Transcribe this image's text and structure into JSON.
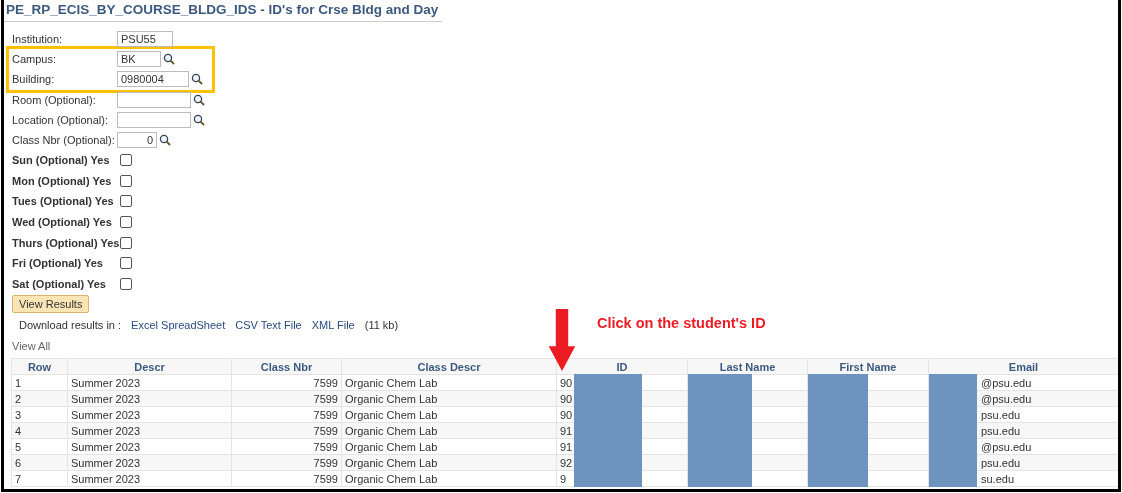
{
  "page_title": "PE_RP_ECIS_BY_COURSE_BLDG_IDS - ID's for Crse Bldg and Day",
  "fields": [
    {
      "label": "Institution:",
      "value": "PSU55",
      "kind": "plain",
      "highlighted": false
    },
    {
      "label": "Campus:",
      "value": "BK",
      "kind": "lookup",
      "highlighted": true
    },
    {
      "label": "Building:",
      "value": "0980004",
      "kind": "lookup",
      "highlighted": true
    },
    {
      "label": "Room (Optional):",
      "kind": "lookup",
      "highlighted": false
    },
    {
      "label": "Location (Optional):",
      "kind": "lookup",
      "highlighted": false
    },
    {
      "label": "Class Nbr (Optional):",
      "value": "0",
      "kind": "number",
      "highlighted": false
    }
  ],
  "day_options": [
    {
      "label": "Sun (Optional) Yes",
      "checked": false
    },
    {
      "label": "Mon (Optional) Yes",
      "checked": false
    },
    {
      "label": "Tues (Optional) Yes",
      "checked": false
    },
    {
      "label": "Wed (Optional) Yes",
      "checked": false
    },
    {
      "label": "Thurs (Optional) Yes",
      "checked": false
    },
    {
      "label": "Fri (Optional) Yes",
      "checked": false
    },
    {
      "label": "Sat (Optional) Yes",
      "checked": false
    }
  ],
  "view_button": "View Results",
  "download": {
    "label": "Download results in :",
    "links": [
      "Excel SpreadSheet",
      "CSV Text File",
      "XML File"
    ],
    "size": "(11 kb)"
  },
  "view_all": "View All",
  "annotation": "Click on the student's ID",
  "table": {
    "columns": [
      "Row",
      "Descr",
      "Class Nbr",
      "Class Descr",
      "ID",
      "Last Name",
      "First Name",
      "Email"
    ],
    "rows": [
      [
        "1",
        "Summer 2023",
        "7599",
        "Organic Chem Lab",
        "90",
        "",
        "",
        "@psu.edu"
      ],
      [
        "2",
        "Summer 2023",
        "7599",
        "Organic Chem Lab",
        "90",
        "",
        "",
        "@psu.edu"
      ],
      [
        "3",
        "Summer 2023",
        "7599",
        "Organic Chem Lab",
        "90",
        "",
        "",
        "psu.edu"
      ],
      [
        "4",
        "Summer 2023",
        "7599",
        "Organic Chem Lab",
        "91",
        "",
        "",
        "psu.edu"
      ],
      [
        "5",
        "Summer 2023",
        "7599",
        "Organic Chem Lab",
        "91",
        "",
        "",
        "@psu.edu"
      ],
      [
        "6",
        "Summer 2023",
        "7599",
        "Organic Chem Lab",
        "92",
        "",
        "",
        "psu.edu"
      ],
      [
        "7",
        "Summer 2023",
        "7599",
        "Organic Chem Lab",
        "9",
        "",
        "",
        "su.edu"
      ]
    ]
  }
}
